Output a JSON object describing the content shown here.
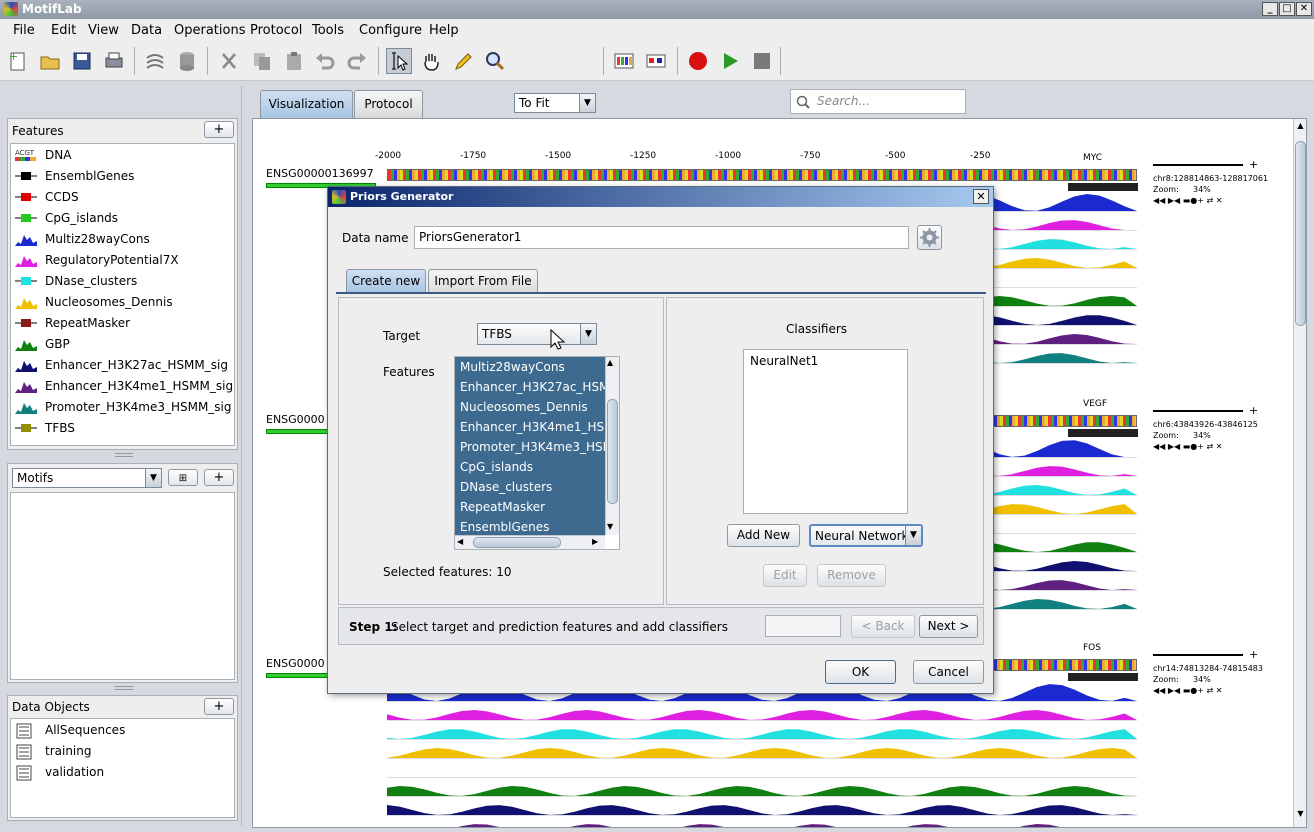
{
  "app": {
    "title": "MotifLab"
  },
  "menu": [
    "File",
    "Edit",
    "View",
    "Data",
    "Operations",
    "Protocol",
    "Tools",
    "Configure",
    "Help"
  ],
  "toolbar": {
    "zoom_value": "To Fit",
    "search_placeholder": "Search..."
  },
  "features_panel": {
    "title": "Features",
    "add": "+",
    "items": [
      {
        "label": "DNA",
        "icon": "dna-icon",
        "color": "#888888"
      },
      {
        "label": "EnsemblGenes",
        "icon": "region-icon",
        "color": "#000000"
      },
      {
        "label": "CCDS",
        "icon": "region-icon",
        "color": "#e00000"
      },
      {
        "label": "CpG_islands",
        "icon": "region-icon",
        "color": "#22cc22"
      },
      {
        "label": "Multiz28wayCons",
        "icon": "numeric-icon",
        "color": "#1a2ad0"
      },
      {
        "label": "RegulatoryPotential7X",
        "icon": "numeric-icon",
        "color": "#e020e0"
      },
      {
        "label": "DNase_clusters",
        "icon": "region-icon",
        "color": "#20e0e0"
      },
      {
        "label": "Nucleosomes_Dennis",
        "icon": "numeric-icon",
        "color": "#f0c000"
      },
      {
        "label": "RepeatMasker",
        "icon": "region-icon",
        "color": "#8b1a1a"
      },
      {
        "label": "GBP",
        "icon": "numeric-icon",
        "color": "#108010"
      },
      {
        "label": "Enhancer_H3K27ac_HSMM_sig",
        "icon": "numeric-icon",
        "color": "#101070"
      },
      {
        "label": "Enhancer_H3K4me1_HSMM_sig",
        "icon": "numeric-icon",
        "color": "#602080"
      },
      {
        "label": "Promoter_H3K4me3_HSMM_sig",
        "icon": "numeric-icon",
        "color": "#108080"
      },
      {
        "label": "TFBS",
        "icon": "region-icon",
        "color": "#909000"
      }
    ]
  },
  "motifs_panel": {
    "selector": "Motifs",
    "add": "+"
  },
  "data_objects_panel": {
    "title": "Data Objects",
    "add": "+",
    "items": [
      "AllSequences",
      "training",
      "validation"
    ]
  },
  "main_tabs": [
    "Visualization",
    "Protocol"
  ],
  "sequences": [
    {
      "name": "ENSG00000136997",
      "gene": "MYC",
      "location": "chr8:128814863-128817061",
      "zoom": "Zoom:",
      "zoom_value": "34%"
    },
    {
      "name": "ENSG0000",
      "gene": "VEGF",
      "location": "chr6:43843926-43846125",
      "zoom": "Zoom:",
      "zoom_value": "34%"
    },
    {
      "name": "ENSG0000",
      "gene": "FOS",
      "location": "chr14:74813284-74815483",
      "zoom": "Zoom:",
      "zoom_value": "34%"
    }
  ],
  "ruler": [
    "-2000",
    "-1750",
    "-1500",
    "-1250",
    "-1000",
    "-750",
    "-500",
    "-250"
  ],
  "dialog": {
    "title": "Priors Generator",
    "data_name_label": "Data name",
    "data_name_value": "PriorsGenerator1",
    "tabs": [
      "Create new",
      "Import From File"
    ],
    "target_label": "Target",
    "target_value": "TFBS",
    "features_label": "Features",
    "features_list": [
      "Multiz28wayCons",
      "Enhancer_H3K27ac_HSM",
      "Nucleosomes_Dennis",
      "Enhancer_H3K4me1_HSM",
      "Promoter_H3K4me3_HSM",
      "CpG_islands",
      "DNase_clusters",
      "RepeatMasker",
      "EnsemblGenes"
    ],
    "selected_features": "Selected features: 10",
    "classifiers_label": "Classifiers",
    "classifiers_list": [
      "NeuralNet1"
    ],
    "add_new": "Add New",
    "classifier_type": "Neural Network",
    "edit": "Edit",
    "remove": "Remove",
    "step_bold": "Step 1:",
    "step_text": "Select target and prediction features and add classifiers",
    "back": "< Back",
    "next": "Next >",
    "ok": "OK",
    "cancel": "Cancel"
  }
}
